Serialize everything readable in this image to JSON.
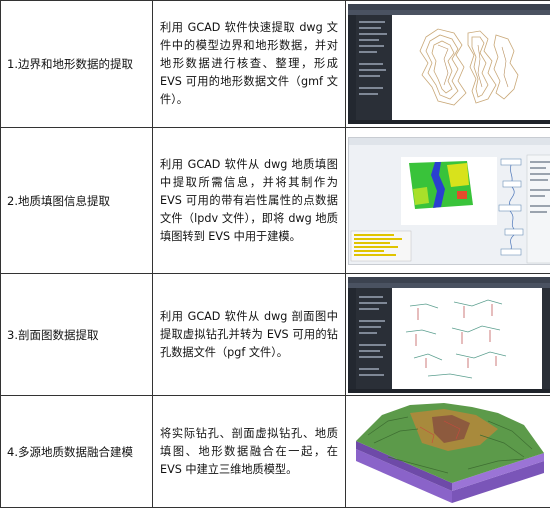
{
  "rows": [
    {
      "step": "1.边界和地形数据的提取",
      "description": "利用 GCAD 软件快速提取 dwg 文件中的模型边界和地形数据，并对地形数据进行核查、整理，形成 EVS 可用的地形数据文件（gmf 文件）。",
      "image_icon": "dwg-terrain-contour-screenshot"
    },
    {
      "step": "2.地质填图信息提取",
      "description": "利用 GCAD 软件从 dwg 地质填图中提取所需信息，并将其制作为 EVS 可用的带有岩性属性的点数据文件（lpdv 文件），即将 dwg 地质填图转到 EVS 中用于建模。",
      "image_icon": "geologic-map-evs-network-screenshot"
    },
    {
      "step": "3.剖面图数据提取",
      "description": "利用 GCAD 软件从 dwg 剖面图中提取虚拟钻孔并转为 EVS 可用的钻孔数据文件（pgf 文件）。",
      "image_icon": "cross-section-virtual-borehole-screenshot"
    },
    {
      "step": "4.多源地质数据融合建模",
      "description": "将实际钻孔、剖面虚拟钻孔、地质填图、地形数据融合在一起，在 EVS 中建立三维地质模型。",
      "image_icon": "3d-geologic-model-render"
    }
  ],
  "colors": {
    "app_dark": "#2c313a",
    "geo_green": "#39c33a",
    "river_blue": "#2a3fd0",
    "model_green": "#5c9a4a",
    "model_purple": "#8a63c9"
  }
}
